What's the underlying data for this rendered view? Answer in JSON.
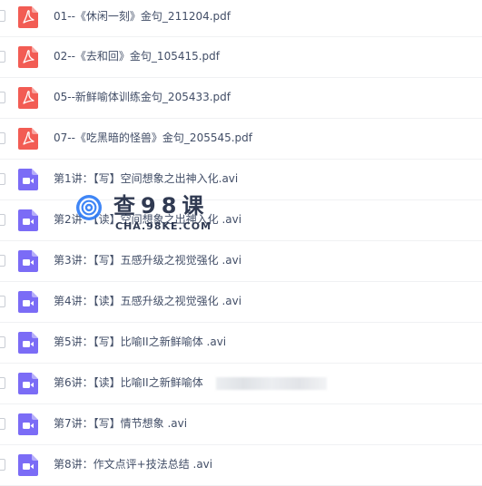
{
  "files": [
    {
      "name": "01--《休闲一刻》金句_211204.pdf",
      "type": "pdf",
      "icon": "pdf-icon"
    },
    {
      "name": "02--《去和回》金句_105415.pdf",
      "type": "pdf",
      "icon": "pdf-icon"
    },
    {
      "name": "05--新鲜喻体训练金句_205433.pdf",
      "type": "pdf",
      "icon": "pdf-icon"
    },
    {
      "name": "07--《吃黑暗的怪兽》金句_205545.pdf",
      "type": "pdf",
      "icon": "pdf-icon"
    },
    {
      "name": "第1讲：【写】空间想象之出神入化.avi",
      "type": "video",
      "icon": "video-icon"
    },
    {
      "name": "第2讲：【读】空间想象之出神入化 .avi",
      "type": "video",
      "icon": "video-icon"
    },
    {
      "name": "第3讲：【写】五感升级之视觉强化 .avi",
      "type": "video",
      "icon": "video-icon"
    },
    {
      "name": "第4讲：【读】五感升级之视觉强化 .avi",
      "type": "video",
      "icon": "video-icon"
    },
    {
      "name": "第5讲：【写】比喻II之新鲜喻体 .avi",
      "type": "video",
      "icon": "video-icon"
    },
    {
      "name": "第6讲：【读】比喻II之新鲜喻体",
      "type": "video",
      "icon": "video-icon"
    },
    {
      "name": "第7讲：【写】情节想象 .avi",
      "type": "video",
      "icon": "video-icon"
    },
    {
      "name": "第8讲：作文点评+技法总结 .avi",
      "type": "video",
      "icon": "video-icon"
    }
  ],
  "watermark": {
    "title": "查98课",
    "subtitle": "CHA.98KE.COM"
  },
  "colors": {
    "pdf": "#f25c54",
    "video": "#7b6cf6",
    "text": "#424e67"
  }
}
